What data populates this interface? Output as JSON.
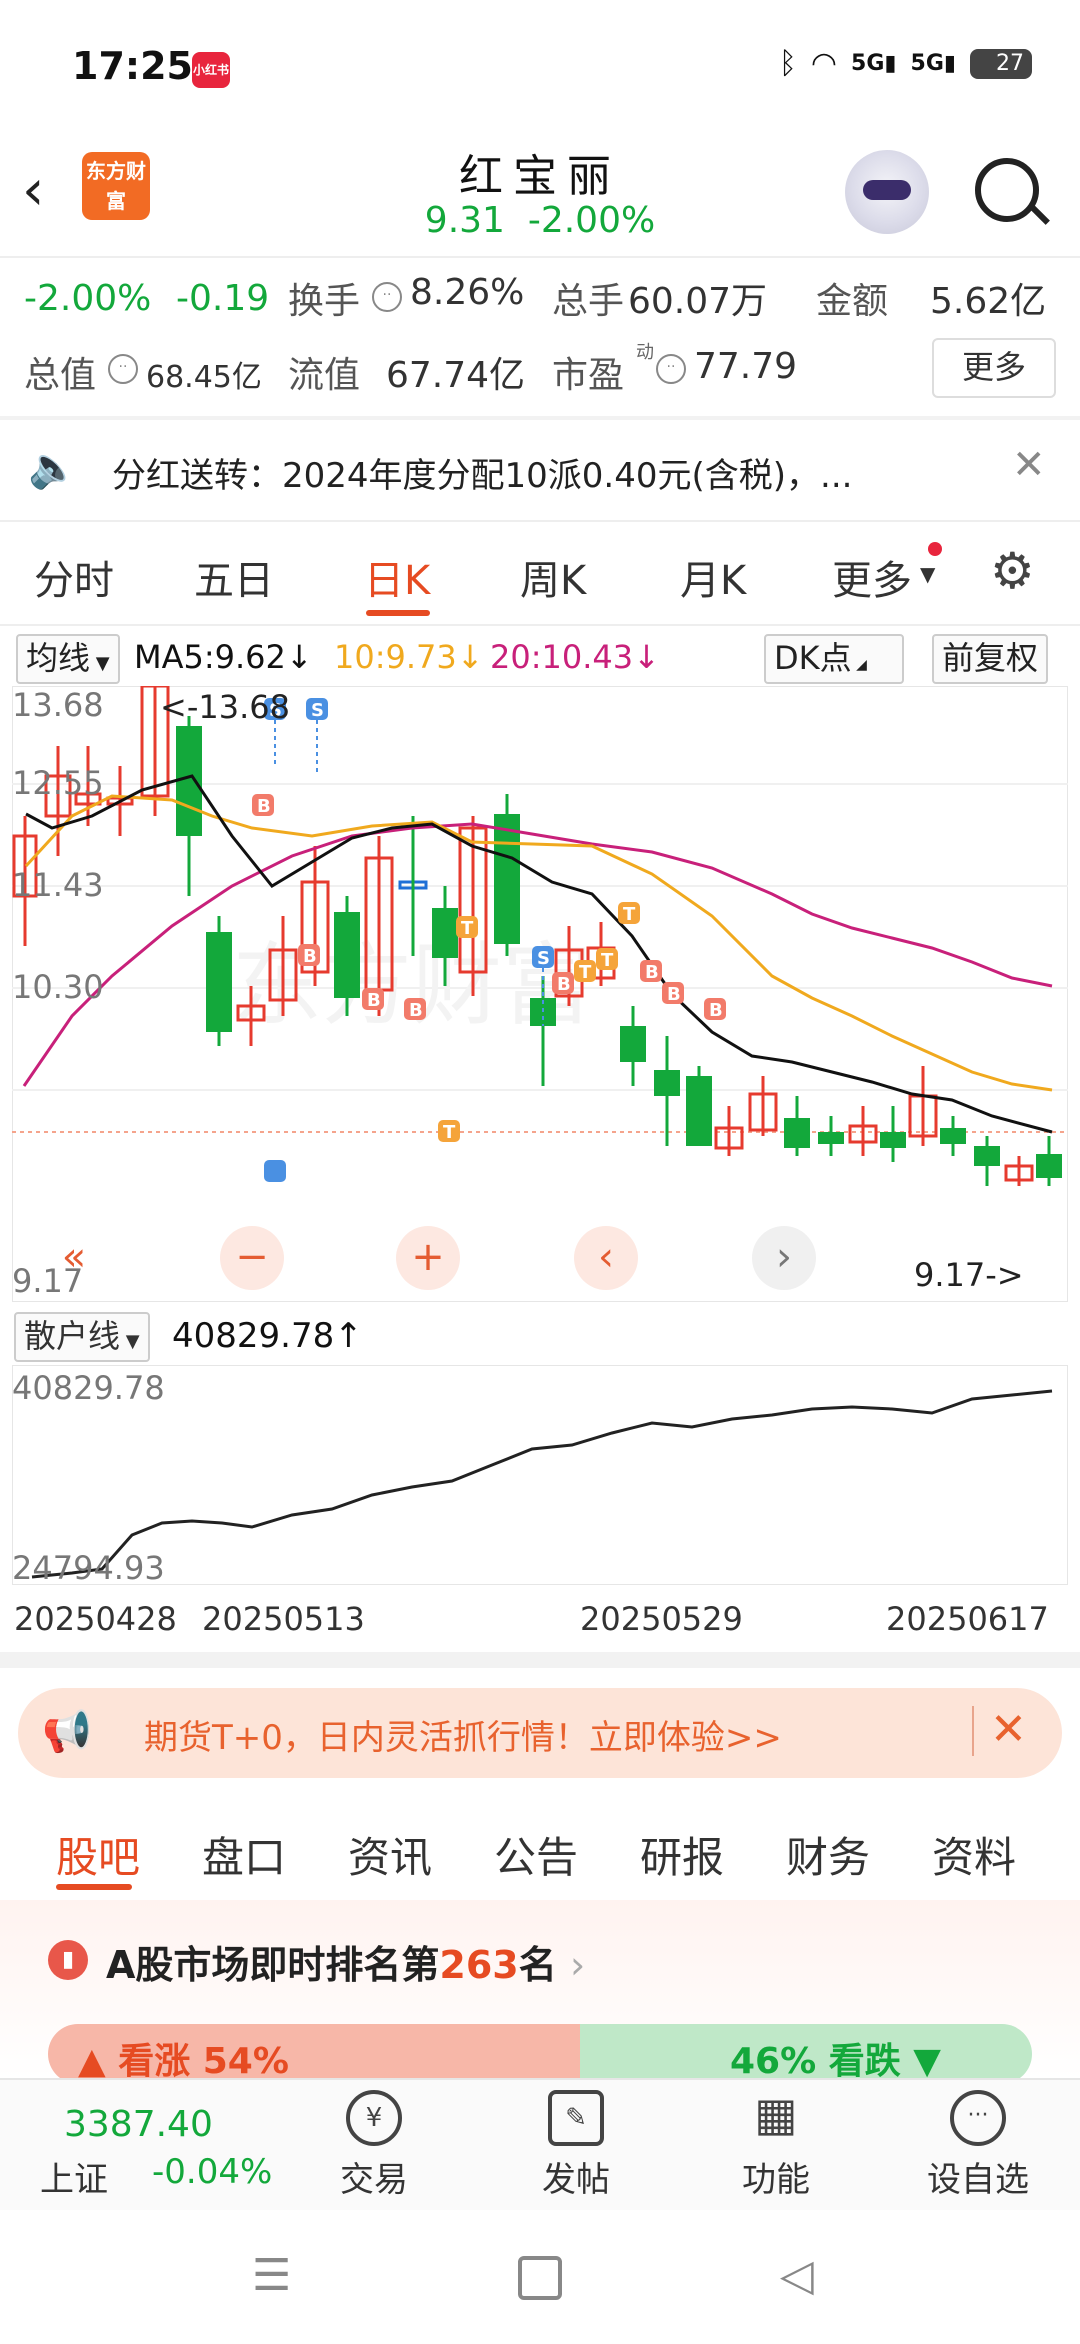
{
  "status_bar": {
    "time": "17:25",
    "notif_app": "小红书",
    "battery": "27"
  },
  "header": {
    "title": "红宝丽",
    "price": "9.31",
    "change_pct": "-2.00%",
    "logo_text": "东方财富"
  },
  "quote": {
    "change_pct": "-2.00%",
    "change_abs": "-0.19",
    "turnover_label": "换手",
    "turnover": "8.26%",
    "volume_label": "总手",
    "volume": "60.07万",
    "amount_label": "金额",
    "amount": "5.62亿",
    "mktcap_label": "总值",
    "mktcap": "68.45亿",
    "float_label": "流值",
    "float_cap": "67.74亿",
    "pe_label": "市盈",
    "pe_sup": "动",
    "pe": "77.79",
    "more_label": "更多"
  },
  "notice": {
    "text": "分红送转：2024年度分配10派0.40元(含税)，..."
  },
  "tabs": [
    {
      "label": "分时"
    },
    {
      "label": "五日"
    },
    {
      "label": "日K"
    },
    {
      "label": "周K"
    },
    {
      "label": "月K"
    },
    {
      "label": "更多"
    }
  ],
  "ma": {
    "type_label": "均线",
    "ma5": "MA5:9.62↓",
    "ma10": "10:9.73↓",
    "ma20": "20:10.43↓",
    "dk_label": "DK点",
    "adjust_label": "前复权",
    "colors": {
      "ma5": "#111111",
      "ma10": "#f0a91e",
      "ma20": "#c8207a"
    }
  },
  "kchart": {
    "y_labels": [
      "13.68",
      "12.55",
      "11.43",
      "10.30",
      "9.17"
    ],
    "max_label": "<-13.68",
    "min_label": "9.17->"
  },
  "indicator": {
    "name": "散户线",
    "value": "40829.78↑",
    "y_top": "40829.78",
    "y_bottom": "24794.93"
  },
  "dates": [
    "20250428",
    "20250513",
    "20250529",
    "20250617"
  ],
  "ad": {
    "text": "期货T+0，日内灵活抓行情！立即体验>>"
  },
  "bottom_tabs": [
    {
      "label": "股吧"
    },
    {
      "label": "盘口"
    },
    {
      "label": "资讯"
    },
    {
      "label": "公告"
    },
    {
      "label": "研报"
    },
    {
      "label": "财务"
    },
    {
      "label": "资料"
    }
  ],
  "rank": {
    "prefix": "A股市场即时排名第",
    "rank": "263",
    "suffix": "名",
    "up_label": "看涨 54%",
    "down_label": "46% 看跌"
  },
  "index": {
    "value": "3387.40",
    "name": "上证",
    "change": "-0.04%"
  },
  "nav": [
    {
      "label": "交易",
      "icon": "¥"
    },
    {
      "label": "发帖",
      "icon": "✎"
    },
    {
      "label": "功能",
      "icon": "▦"
    },
    {
      "label": "设自选",
      "icon": "···"
    }
  ]
}
